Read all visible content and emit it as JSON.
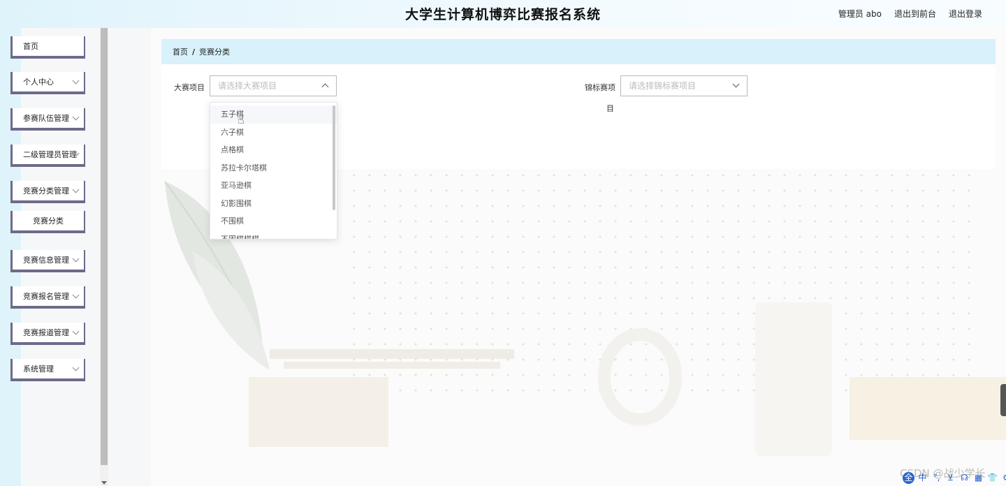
{
  "header": {
    "title": "大学生计算机博弈比赛报名系统",
    "admin": "管理员 abo",
    "to_front": "退出到前台",
    "logout": "退出登录"
  },
  "sidebar": {
    "items": [
      {
        "label": "首页",
        "expandable": false
      },
      {
        "label": "个人中心",
        "expandable": true
      },
      {
        "label": "参赛队伍管理",
        "expandable": true
      },
      {
        "label": "二级管理员管理",
        "expandable": true
      },
      {
        "label": "竞赛分类管理",
        "expandable": true
      },
      {
        "label": "竞赛分类",
        "expandable": false,
        "sub": true
      },
      {
        "label": "竞赛信息管理",
        "expandable": true
      },
      {
        "label": "竞赛报名管理",
        "expandable": true
      },
      {
        "label": "竞赛报道管理",
        "expandable": true
      },
      {
        "label": "系统管理",
        "expandable": true
      }
    ]
  },
  "breadcrumb": {
    "home": "首页",
    "separator": "/",
    "current": "竞赛分类"
  },
  "filters": {
    "major": {
      "label": "大赛项目",
      "placeholder": "请选择大赛项目"
    },
    "minor": {
      "label_line1": "锦标赛项",
      "label_line2": "目",
      "placeholder": "请选择锦标赛项目"
    }
  },
  "dropdown": {
    "options": [
      "五子棋",
      "六子棋",
      "点格棋",
      "苏拉卡尔塔棋",
      "亚马逊棋",
      "幻影围棋",
      "不围棋",
      "不围棋棋棋"
    ],
    "hovered_index": 0
  },
  "watermark": "CSDN @战少学长",
  "tray_icons": [
    "全",
    "中",
    "°,",
    "⊻",
    "☊",
    "▦",
    "👕",
    "⚙"
  ],
  "colors": {
    "accent_border": "#6d6a89",
    "breadcrumb_bg": "#d8f1fb",
    "header_bg": "#dff3fb"
  }
}
